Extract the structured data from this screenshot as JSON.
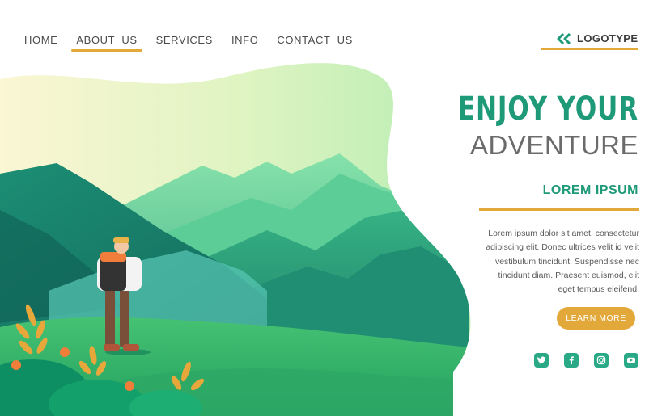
{
  "nav": {
    "items": [
      {
        "label": "HOME",
        "active": false
      },
      {
        "label": "ABOUT  US",
        "active": true
      },
      {
        "label": "SERVICES",
        "active": false
      },
      {
        "label": "INFO",
        "active": false
      },
      {
        "label": "CONTACT  US",
        "active": false
      }
    ]
  },
  "logo": {
    "text": "LOGOTYPE",
    "icon": "double-chevron-left-icon"
  },
  "hero": {
    "title_line1": "ENJOY YOUR",
    "title_line2": "ADVENTURE",
    "subtitle": "LOREM IPSUM",
    "body_lines": [
      "Lorem ipsum dolor sit amet, consectetur",
      "adipiscing elit. Donec ultrices velit id velit",
      "vestibulum tincidunt. Suspendisse nec",
      "tincidunt diam. Praesent euismod, elit",
      "eget tempus eleifend."
    ],
    "button_label": "LEARN MORE"
  },
  "socials": [
    {
      "name": "twitter-icon"
    },
    {
      "name": "facebook-icon"
    },
    {
      "name": "instagram-icon"
    },
    {
      "name": "youtube-icon"
    }
  ],
  "colors": {
    "accent_green": "#1f9a78",
    "accent_gold": "#e2a83a",
    "title_gray": "#6b6b6b",
    "social_green": "#2aa987"
  }
}
